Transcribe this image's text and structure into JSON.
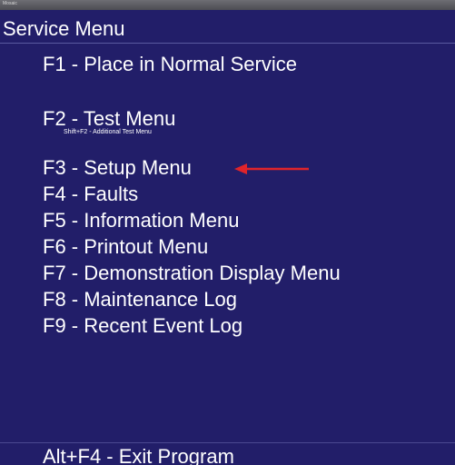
{
  "window": {
    "title": "Mosaic"
  },
  "header": {
    "title": "Service Menu"
  },
  "menu": {
    "items": [
      {
        "key": "F1",
        "label": "F1 - Place in Normal Service"
      },
      {
        "key": "F2",
        "label": "F2 - Test Menu",
        "note": "Shift+F2 - Additional Test Menu"
      },
      {
        "key": "F3",
        "label": "F3 - Setup Menu"
      },
      {
        "key": "F4",
        "label": "F4 - Faults"
      },
      {
        "key": "F5",
        "label": "F5 - Information Menu"
      },
      {
        "key": "F6",
        "label": "F6 - Printout Menu"
      },
      {
        "key": "F7",
        "label": "F7 - Demonstration Display Menu"
      },
      {
        "key": "F8",
        "label": "F8 - Maintenance Log"
      },
      {
        "key": "F9",
        "label": "F9 - Recent Event Log"
      }
    ],
    "exit_label": "Alt+F4 - Exit Program"
  },
  "colors": {
    "background": "#221e69",
    "text": "#ffffff",
    "arrow": "#e0242a"
  },
  "icons": {
    "arrow": "red-arrow-left-icon"
  }
}
